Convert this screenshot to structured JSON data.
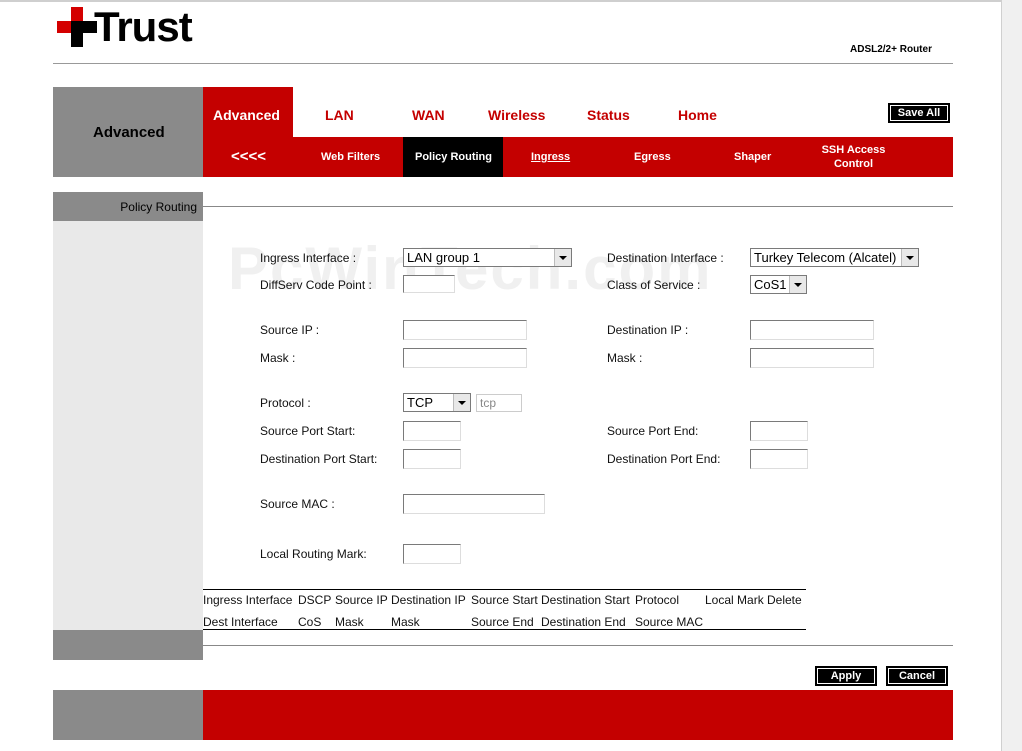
{
  "brand": {
    "name": "Trust",
    "product": "ADSL2/2+ Router"
  },
  "nav": {
    "section": "Advanced",
    "tabs": [
      "Advanced",
      "LAN",
      "WAN",
      "Wireless",
      "Status",
      "Home"
    ],
    "save_all": "Save All"
  },
  "subnav": {
    "back": "<<<<",
    "items": [
      "Web Filters",
      "Policy Routing",
      "Ingress",
      "Egress",
      "Shaper"
    ],
    "ssh_line1": "SSH Access",
    "ssh_line2": "Control"
  },
  "side": {
    "title": "Policy Routing"
  },
  "watermark": "PcWinTech.com",
  "form": {
    "ingress_interface": {
      "label": "Ingress Interface :",
      "value": "LAN group 1"
    },
    "destination_interface": {
      "label": "Destination Interface :",
      "value": "Turkey Telecom (Alcatel)"
    },
    "diffserv": {
      "label": "DiffServ Code Point :",
      "value": ""
    },
    "class_of_service": {
      "label": "Class of Service :",
      "value": "CoS1"
    },
    "source_ip": {
      "label": "Source IP :",
      "value": ""
    },
    "destination_ip": {
      "label": "Destination IP :",
      "value": ""
    },
    "source_mask": {
      "label": "Mask :",
      "value": ""
    },
    "destination_mask": {
      "label": "Mask :",
      "value": ""
    },
    "protocol": {
      "label": "Protocol :",
      "value": "TCP",
      "text_value": "tcp"
    },
    "source_port_start": {
      "label": "Source Port Start:",
      "value": ""
    },
    "source_port_end": {
      "label": "Source Port End:",
      "value": ""
    },
    "dest_port_start": {
      "label": "Destination Port Start:",
      "value": ""
    },
    "dest_port_end": {
      "label": "Destination Port End:",
      "value": ""
    },
    "source_mac": {
      "label": "Source MAC :",
      "value": ""
    },
    "local_routing_mark": {
      "label": "Local Routing Mark:",
      "value": ""
    }
  },
  "table": {
    "row1": [
      "Ingress Interface",
      "DSCP",
      "Source IP",
      "Destination IP",
      "Source Start",
      "Destination Start",
      "Protocol",
      "Local Mark",
      "Delete"
    ],
    "row2": [
      "Dest Interface",
      "CoS",
      "Mask",
      "Mask",
      "Source End",
      "Destination End",
      "Source MAC"
    ]
  },
  "actions": {
    "apply": "Apply",
    "cancel": "Cancel"
  },
  "colors": {
    "brand_red": "#c40000",
    "nav_gray": "#8a8a8a",
    "side_gray": "#e9e9e9"
  }
}
